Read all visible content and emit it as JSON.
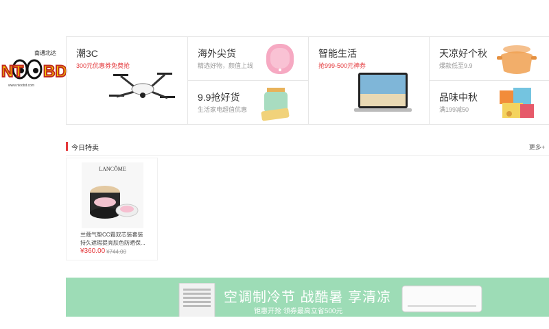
{
  "logo": {
    "text": "NTOOBD",
    "tagline": "南通北达",
    "url_text": "www.ntoobd.com"
  },
  "categories": [
    {
      "title": "潮3C",
      "subtitle": "300元优惠券免费抢",
      "subtitle_red": true
    },
    {
      "title": "海外尖货",
      "subtitle": "精选好物，颜值上线",
      "subtitle_red": false
    },
    {
      "title": "9.9抢好货",
      "subtitle": "生活家电超值优惠",
      "subtitle_red": false
    },
    {
      "title": "智能生活",
      "subtitle": "抢999-500元神券",
      "subtitle_red": true
    },
    {
      "title": "天凉好个秋",
      "subtitle": "爆款低至9.9",
      "subtitle_red": false
    },
    {
      "title": "品味中秋",
      "subtitle": "满199减50",
      "subtitle_red": false
    }
  ],
  "section": {
    "title": "今日特卖",
    "more": "更多+"
  },
  "products": [
    {
      "brand": "LANCÔME",
      "name": "兰蔻气垫CC霜双芯装套装 持久遮瑕提亮肤色防晒保...",
      "price": "¥360.00",
      "old_price": "¥744.00"
    }
  ],
  "banner": {
    "title": "空调制冷节 战酷暑 享清凉",
    "subtitle": "钜惠开抢 领券最高立省500元"
  },
  "colors": {
    "accent": "#e4393c",
    "banner_bg": "#9ddcb6"
  }
}
